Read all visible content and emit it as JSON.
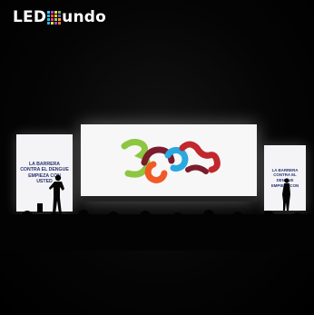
{
  "watermark": {
    "text_before": "LED",
    "text_after": "undo",
    "grid_colors": [
      "#4fc3f7",
      "#ab47bc",
      "#ffd54f",
      "#66bb6a",
      "#29b6f6",
      "#ef5350",
      "#ffca28",
      "#7e57c2",
      "#26c6da",
      "#ec407a",
      "#9ccc65",
      "#ffa726",
      "#42a5f5",
      "#d4e157",
      "#ab47bc",
      "#ff7043"
    ]
  },
  "left_screen": {
    "text": "LA BARRERA\nCONTRA EL DENGUE\nEMPIEZA CON\nUSTED"
  },
  "right_screen": {
    "text": "LA BARRERA\nCONTRA EL DENGUE\nEMPIEZA CON"
  },
  "main_screen": {
    "logo_colors": [
      "#8dc63f",
      "#7b1c2c",
      "#29a9e0",
      "#f15a24",
      "#c1272d"
    ]
  }
}
